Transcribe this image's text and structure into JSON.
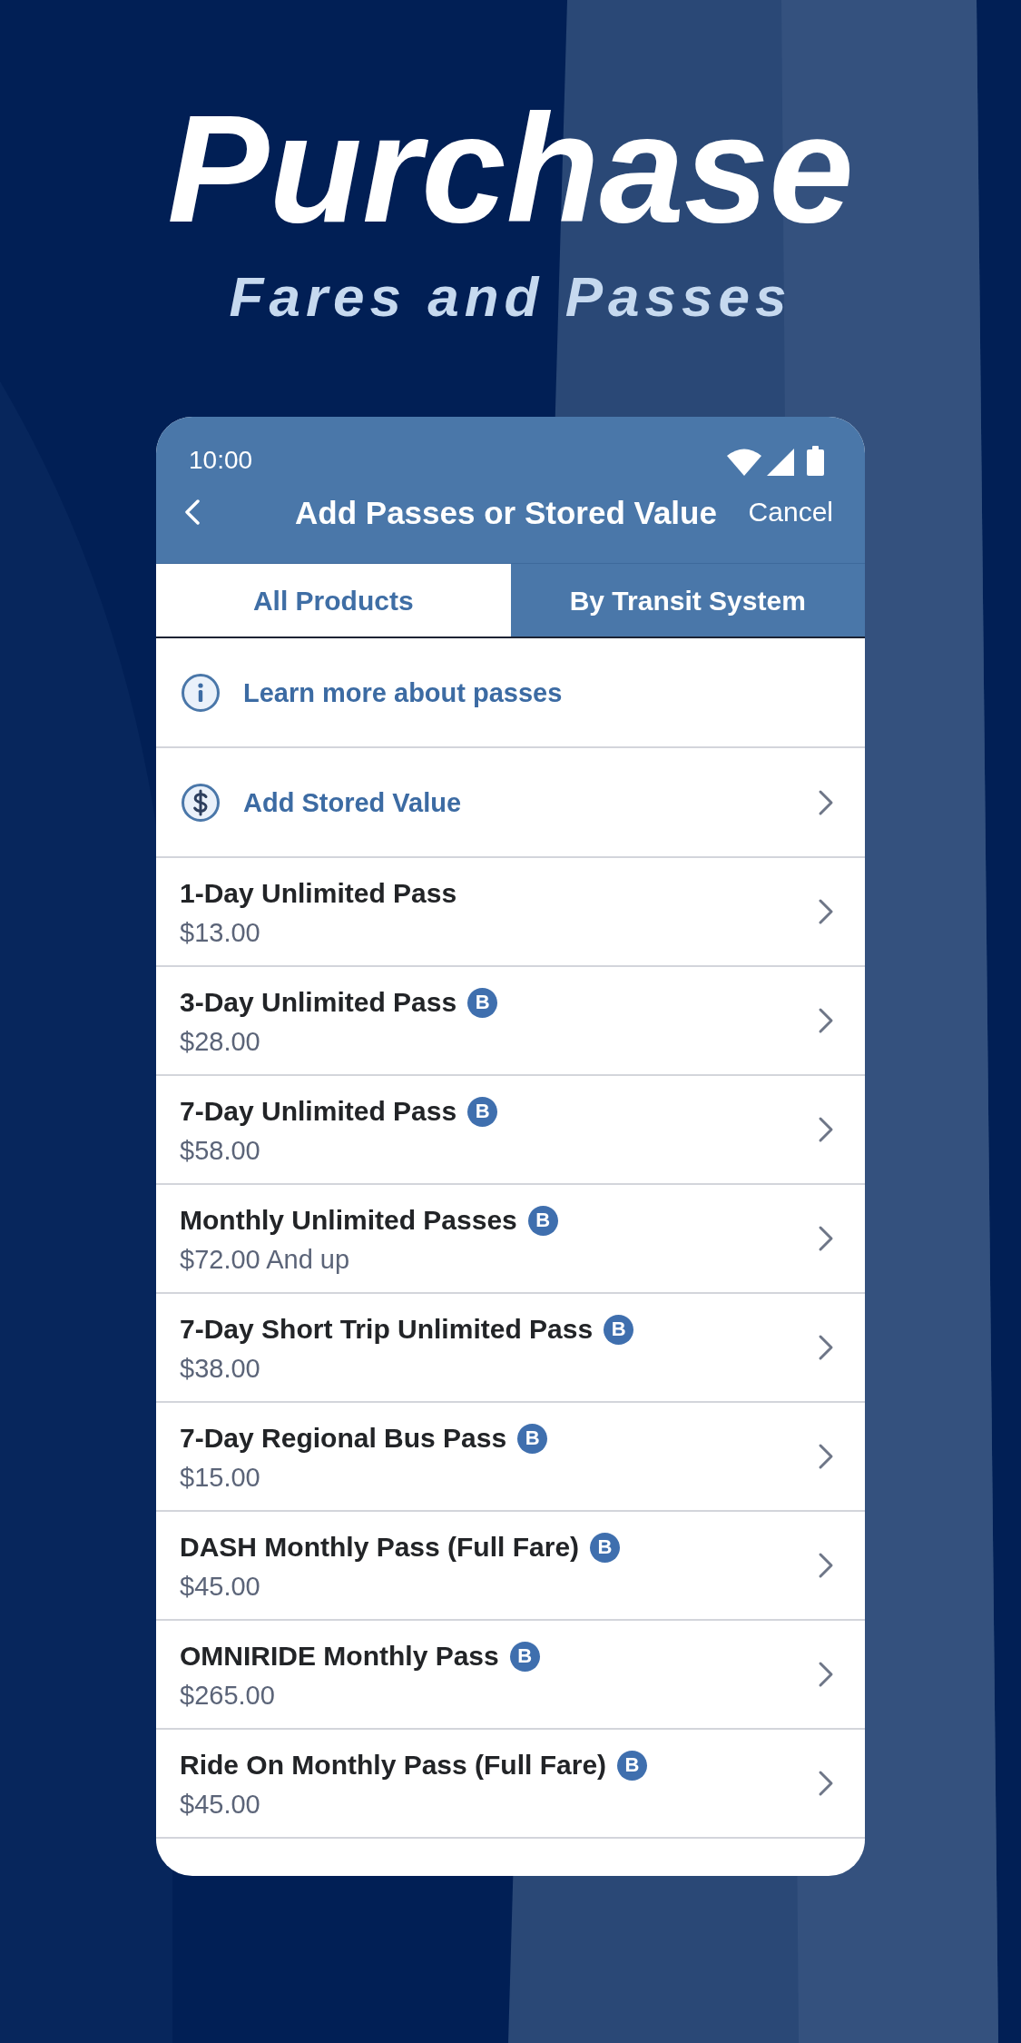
{
  "promo": {
    "headline": "Purchase",
    "subheadline": "Fares and Passes"
  },
  "status_bar": {
    "time": "10:00"
  },
  "nav_bar": {
    "title": "Add Passes or Stored Value",
    "action": "Cancel"
  },
  "tabs": [
    {
      "label": "All Products",
      "selected": true
    },
    {
      "label": "By Transit System",
      "selected": false
    }
  ],
  "links": [
    {
      "kind": "info",
      "label": "Learn more about passes"
    },
    {
      "kind": "stored_value",
      "label": "Add Stored Value"
    }
  ],
  "products": [
    {
      "name": "1-Day Unlimited Pass",
      "price": "$13.00"
    },
    {
      "name": "3-Day Unlimited Pass",
      "badge": "B",
      "price": "$28.00"
    },
    {
      "name": "7-Day Unlimited Pass",
      "badge": "B",
      "price": "$58.00"
    },
    {
      "name": "Monthly Unlimited Passes",
      "badge": "B",
      "price": "$72.00 And up"
    },
    {
      "name": "7-Day Short Trip Unlimited Pass",
      "badge": "B",
      "price": "$38.00"
    },
    {
      "name": "7-Day Regional Bus Pass",
      "badge": "B",
      "price": "$15.00"
    },
    {
      "name": "DASH Monthly Pass (Full Fare)",
      "badge": "B",
      "price": "$45.00"
    },
    {
      "name": "OMNIRIDE Monthly Pass",
      "badge": "B",
      "price": "$265.00"
    },
    {
      "name": "Ride On Monthly Pass (Full Fare)",
      "badge": "B",
      "price": "$45.00"
    }
  ]
}
